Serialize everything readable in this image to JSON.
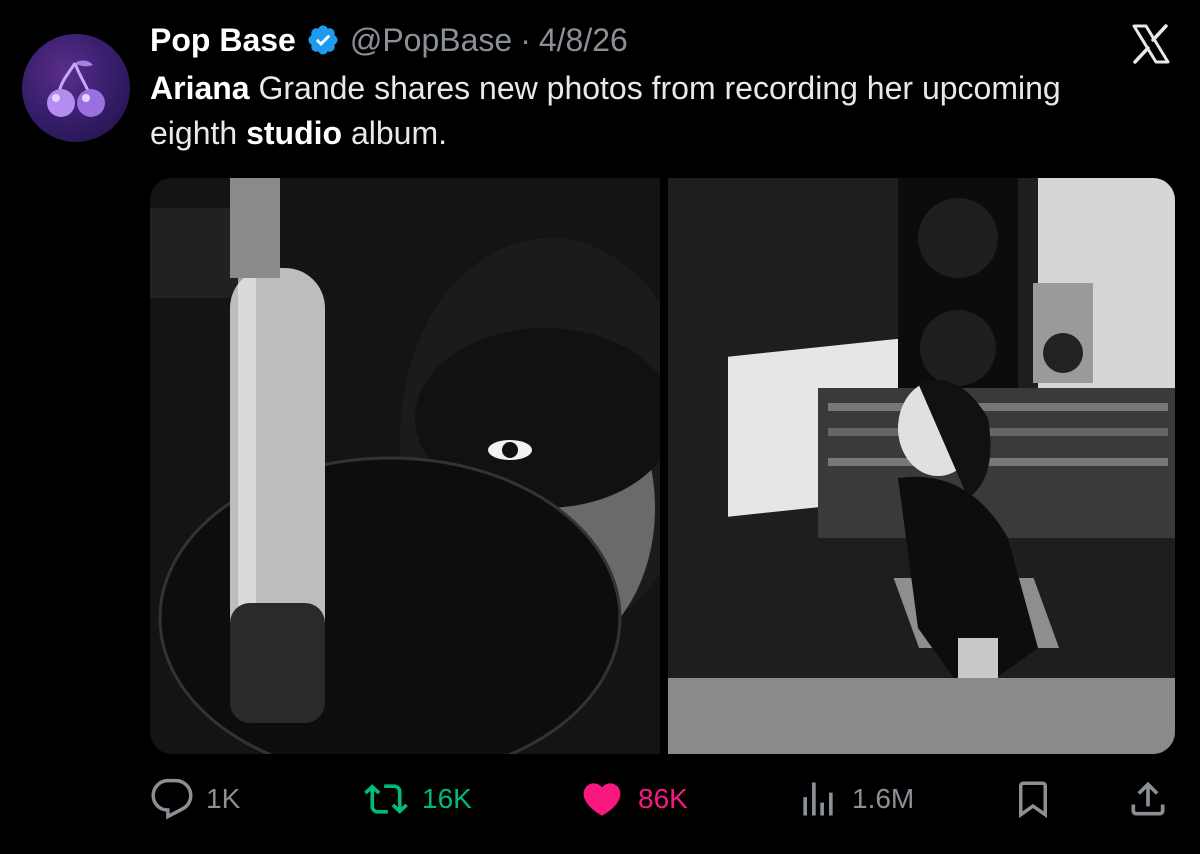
{
  "tweet": {
    "display_name": "Pop Base",
    "handle": "@PopBase",
    "separator": "·",
    "date": "4/8/26",
    "text_parts": [
      {
        "text": "Ariana",
        "bold": true
      },
      {
        "text": " Grande shares new photos from recording her upcoming eighth ",
        "bold": false
      },
      {
        "text": "studio",
        "bold": true
      },
      {
        "text": " album.",
        "bold": false
      }
    ]
  },
  "actions": {
    "replies": "1K",
    "reposts": "16K",
    "likes": "86K",
    "views": "1.6M"
  },
  "icons": {
    "close": "x-logo-icon",
    "verified": "verified-badge-icon",
    "reply": "reply-icon",
    "repost": "repost-icon",
    "like": "heart-icon",
    "views": "views-chart-icon",
    "bookmark": "bookmark-icon",
    "share": "share-icon"
  },
  "colors": {
    "background": "#000000",
    "verified": "#1d9bf0",
    "repost": "#00ba7c",
    "like": "#f91880",
    "muted": "#8b9096"
  }
}
